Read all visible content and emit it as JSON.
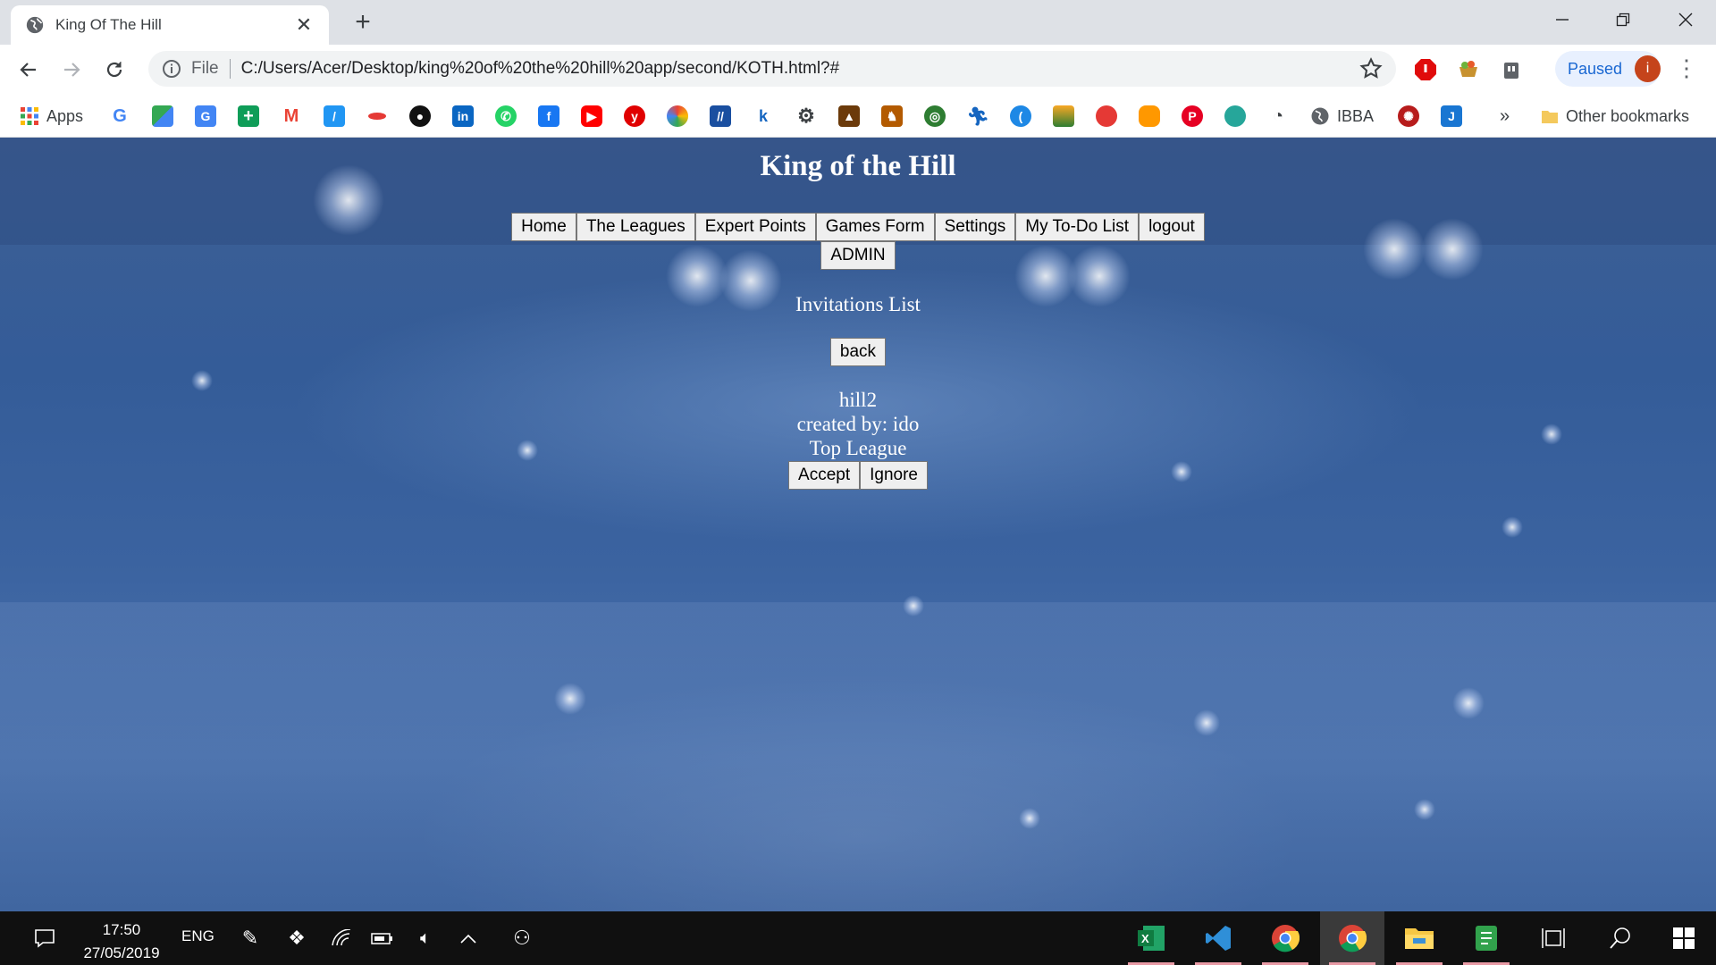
{
  "browser": {
    "tab_title": "King Of The Hill",
    "url_scheme": "File",
    "url": "C:/Users/Acer/Desktop/king%20of%20the%20hill%20app/second/KOTH.html?#",
    "profile_status": "Paused",
    "profile_initial": "i",
    "bookmarks": {
      "apps_label": "Apps",
      "ibba_label": "IBBA",
      "overflow": "»",
      "other_label": "Other bookmarks"
    }
  },
  "page": {
    "title": "King of the Hill",
    "menu": [
      "Home",
      "The Leagues",
      "Expert Points",
      "Games Form",
      "Settings",
      "My To-Do List",
      "logout"
    ],
    "admin_label": "ADMIN",
    "section_title": "Invitations List",
    "back_label": "back",
    "invitation": {
      "name": "hill2",
      "created_by": "created by: ido",
      "league": "Top League",
      "accept_label": "Accept",
      "ignore_label": "Ignore"
    }
  },
  "taskbar": {
    "time": "17:50",
    "date": "27/05/2019",
    "language": "ENG"
  },
  "colors": {
    "accent": "#1967d2",
    "page_background": "#3b63a0",
    "avatar": "#c5441b"
  }
}
